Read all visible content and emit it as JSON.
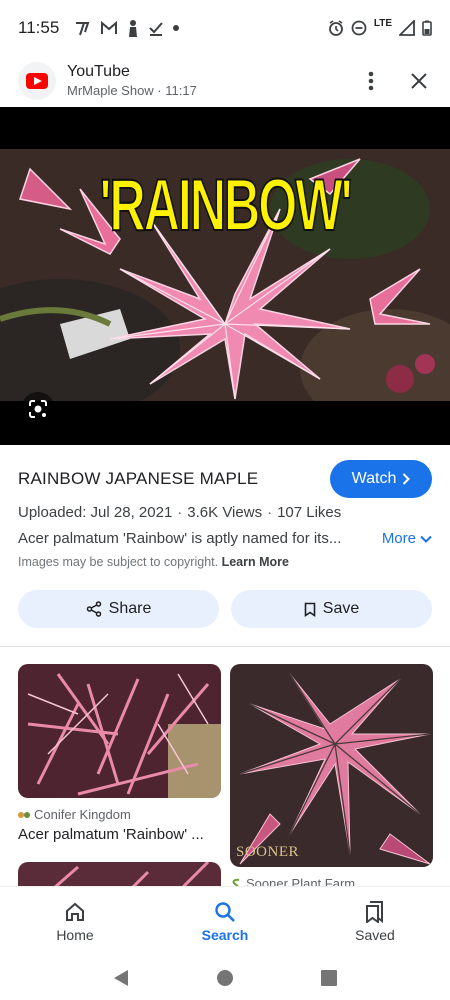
{
  "status_bar": {
    "time": "11:55",
    "network": "LTE"
  },
  "header": {
    "source_name": "YouTube",
    "subtitle": "MrMaple Show · 11:17",
    "icons": [
      "youtube-logo",
      "more-vert-icon",
      "close-icon"
    ]
  },
  "hero": {
    "caption": "'RAINBOW'",
    "icons": [
      "lens-icon"
    ]
  },
  "result": {
    "title": "RAINBOW JAPANESE MAPLE",
    "watch_label": "Watch",
    "uploaded": "Uploaded: Jul 28, 2021",
    "views": "3.6K Views",
    "likes": "107 Likes",
    "description": "Acer palmatum 'Rainbow' is aptly named for its...",
    "more_label": "More",
    "copyright_text": "Images may be subject to copyright.",
    "learn_more": "Learn More",
    "share_label": "Share",
    "save_label": "Save"
  },
  "related": [
    {
      "source": "Conifer Kingdom",
      "title": "Acer palmatum 'Rainbow' ..."
    },
    {
      "source": "Sooner Plant Farm",
      "watermark": "SOONER"
    }
  ],
  "bottom_nav": {
    "items": [
      {
        "label": "Home",
        "icon": "home-icon"
      },
      {
        "label": "Search",
        "icon": "search-icon",
        "active": true
      },
      {
        "label": "Saved",
        "icon": "bookmarks-icon"
      }
    ]
  },
  "system_nav": [
    "back-icon",
    "home-circle-icon",
    "recents-icon"
  ],
  "colors": {
    "accent": "#1a73e8",
    "pill_bg": "#e8f0fe",
    "caption_yellow": "#fff200",
    "youtube_red": "#ff0000"
  }
}
